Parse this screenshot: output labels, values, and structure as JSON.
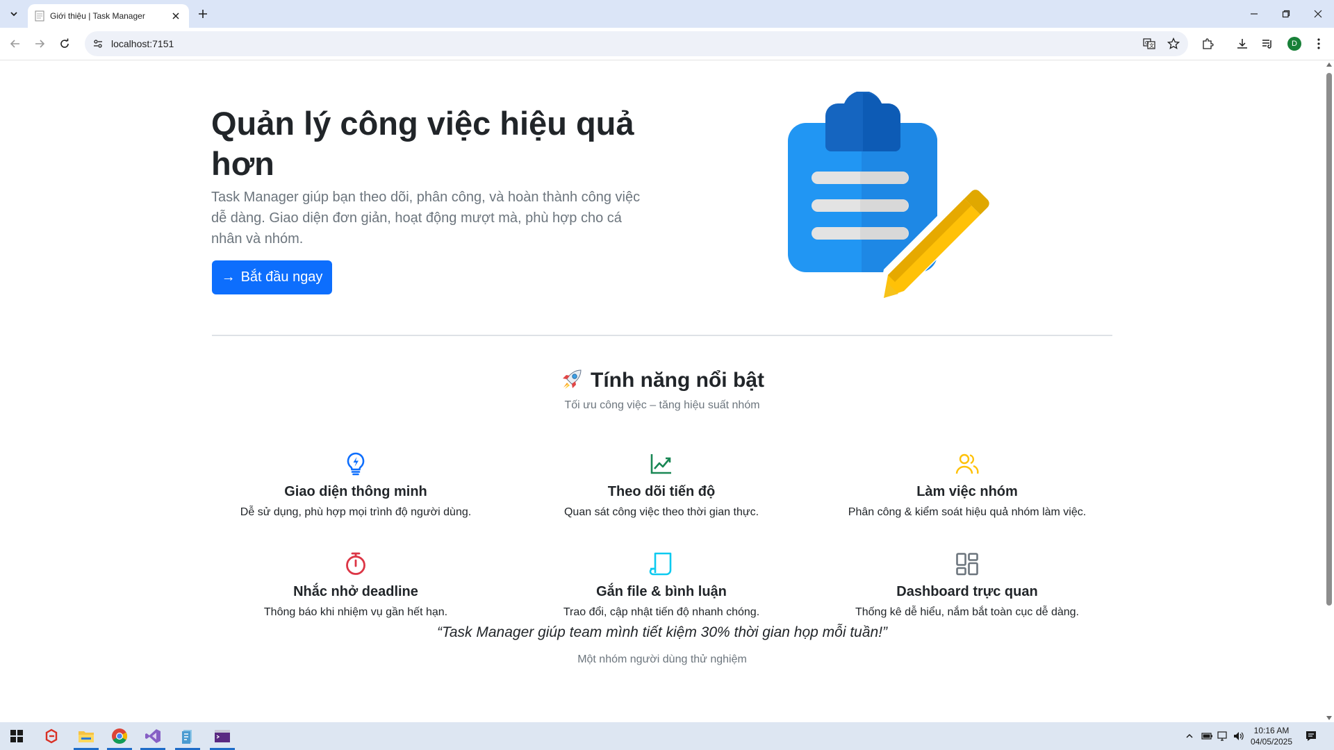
{
  "browser": {
    "tab_title": "Giới thiệu | Task Manager",
    "url": "localhost:7151",
    "profile_initial": "D"
  },
  "hero": {
    "title": "Quản lý công việc hiệu quả hơn",
    "description": "Task Manager giúp bạn theo dõi, phân công, và hoàn thành công việc dễ dàng. Giao diện đơn giản, hoạt động mượt mà, phù hợp cho cá nhân và nhóm.",
    "cta_label": "Bắt đầu ngay",
    "illustration": "clipboard-pencil-icon"
  },
  "features": {
    "title": "Tính năng nổi bật",
    "subtitle": "Tối ưu công việc – tăng hiệu suất nhóm",
    "items": [
      {
        "icon": "lightbulb-icon",
        "color": "#0d6efd",
        "title": "Giao diện thông minh",
        "desc": "Dễ sử dụng, phù hợp mọi trình độ người dùng."
      },
      {
        "icon": "graph-up-icon",
        "color": "#198754",
        "title": "Theo dõi tiến độ",
        "desc": "Quan sát công việc theo thời gian thực."
      },
      {
        "icon": "people-icon",
        "color": "#ffc107",
        "title": "Làm việc nhóm",
        "desc": "Phân công & kiểm soát hiệu quả nhóm làm việc."
      },
      {
        "icon": "stopwatch-icon",
        "color": "#dc3545",
        "title": "Nhắc nhở deadline",
        "desc": "Thông báo khi nhiệm vụ gần hết hạn."
      },
      {
        "icon": "journal-icon",
        "color": "#0dcaf0",
        "title": "Gắn file & bình luận",
        "desc": "Trao đổi, cập nhật tiến độ nhanh chóng."
      },
      {
        "icon": "grid-icon",
        "color": "#6c757d",
        "title": "Dashboard trực quan",
        "desc": "Thống kê dễ hiểu, nắm bắt toàn cục dễ dàng."
      }
    ]
  },
  "testimonial": {
    "quote": "“Task Manager giúp team mình tiết kiệm 30% thời gian họp mỗi tuần!”",
    "author": "Một nhóm người dùng thử nghiệm"
  },
  "taskbar": {
    "time": "10:16 AM",
    "date": "04/05/2025"
  }
}
